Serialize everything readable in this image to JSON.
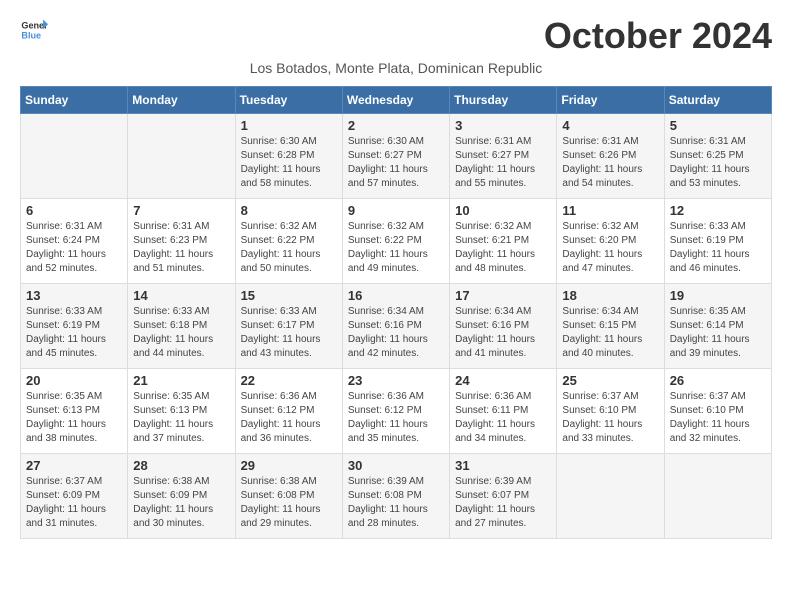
{
  "logo": {
    "line1": "General",
    "line2": "Blue"
  },
  "title": "October 2024",
  "subtitle": "Los Botados, Monte Plata, Dominican Republic",
  "days_of_week": [
    "Sunday",
    "Monday",
    "Tuesday",
    "Wednesday",
    "Thursday",
    "Friday",
    "Saturday"
  ],
  "weeks": [
    [
      {
        "day": "",
        "detail": ""
      },
      {
        "day": "",
        "detail": ""
      },
      {
        "day": "1",
        "detail": "Sunrise: 6:30 AM\nSunset: 6:28 PM\nDaylight: 11 hours and 58 minutes."
      },
      {
        "day": "2",
        "detail": "Sunrise: 6:30 AM\nSunset: 6:27 PM\nDaylight: 11 hours and 57 minutes."
      },
      {
        "day": "3",
        "detail": "Sunrise: 6:31 AM\nSunset: 6:27 PM\nDaylight: 11 hours and 55 minutes."
      },
      {
        "day": "4",
        "detail": "Sunrise: 6:31 AM\nSunset: 6:26 PM\nDaylight: 11 hours and 54 minutes."
      },
      {
        "day": "5",
        "detail": "Sunrise: 6:31 AM\nSunset: 6:25 PM\nDaylight: 11 hours and 53 minutes."
      }
    ],
    [
      {
        "day": "6",
        "detail": "Sunrise: 6:31 AM\nSunset: 6:24 PM\nDaylight: 11 hours and 52 minutes."
      },
      {
        "day": "7",
        "detail": "Sunrise: 6:31 AM\nSunset: 6:23 PM\nDaylight: 11 hours and 51 minutes."
      },
      {
        "day": "8",
        "detail": "Sunrise: 6:32 AM\nSunset: 6:22 PM\nDaylight: 11 hours and 50 minutes."
      },
      {
        "day": "9",
        "detail": "Sunrise: 6:32 AM\nSunset: 6:22 PM\nDaylight: 11 hours and 49 minutes."
      },
      {
        "day": "10",
        "detail": "Sunrise: 6:32 AM\nSunset: 6:21 PM\nDaylight: 11 hours and 48 minutes."
      },
      {
        "day": "11",
        "detail": "Sunrise: 6:32 AM\nSunset: 6:20 PM\nDaylight: 11 hours and 47 minutes."
      },
      {
        "day": "12",
        "detail": "Sunrise: 6:33 AM\nSunset: 6:19 PM\nDaylight: 11 hours and 46 minutes."
      }
    ],
    [
      {
        "day": "13",
        "detail": "Sunrise: 6:33 AM\nSunset: 6:19 PM\nDaylight: 11 hours and 45 minutes."
      },
      {
        "day": "14",
        "detail": "Sunrise: 6:33 AM\nSunset: 6:18 PM\nDaylight: 11 hours and 44 minutes."
      },
      {
        "day": "15",
        "detail": "Sunrise: 6:33 AM\nSunset: 6:17 PM\nDaylight: 11 hours and 43 minutes."
      },
      {
        "day": "16",
        "detail": "Sunrise: 6:34 AM\nSunset: 6:16 PM\nDaylight: 11 hours and 42 minutes."
      },
      {
        "day": "17",
        "detail": "Sunrise: 6:34 AM\nSunset: 6:16 PM\nDaylight: 11 hours and 41 minutes."
      },
      {
        "day": "18",
        "detail": "Sunrise: 6:34 AM\nSunset: 6:15 PM\nDaylight: 11 hours and 40 minutes."
      },
      {
        "day": "19",
        "detail": "Sunrise: 6:35 AM\nSunset: 6:14 PM\nDaylight: 11 hours and 39 minutes."
      }
    ],
    [
      {
        "day": "20",
        "detail": "Sunrise: 6:35 AM\nSunset: 6:13 PM\nDaylight: 11 hours and 38 minutes."
      },
      {
        "day": "21",
        "detail": "Sunrise: 6:35 AM\nSunset: 6:13 PM\nDaylight: 11 hours and 37 minutes."
      },
      {
        "day": "22",
        "detail": "Sunrise: 6:36 AM\nSunset: 6:12 PM\nDaylight: 11 hours and 36 minutes."
      },
      {
        "day": "23",
        "detail": "Sunrise: 6:36 AM\nSunset: 6:12 PM\nDaylight: 11 hours and 35 minutes."
      },
      {
        "day": "24",
        "detail": "Sunrise: 6:36 AM\nSunset: 6:11 PM\nDaylight: 11 hours and 34 minutes."
      },
      {
        "day": "25",
        "detail": "Sunrise: 6:37 AM\nSunset: 6:10 PM\nDaylight: 11 hours and 33 minutes."
      },
      {
        "day": "26",
        "detail": "Sunrise: 6:37 AM\nSunset: 6:10 PM\nDaylight: 11 hours and 32 minutes."
      }
    ],
    [
      {
        "day": "27",
        "detail": "Sunrise: 6:37 AM\nSunset: 6:09 PM\nDaylight: 11 hours and 31 minutes."
      },
      {
        "day": "28",
        "detail": "Sunrise: 6:38 AM\nSunset: 6:09 PM\nDaylight: 11 hours and 30 minutes."
      },
      {
        "day": "29",
        "detail": "Sunrise: 6:38 AM\nSunset: 6:08 PM\nDaylight: 11 hours and 29 minutes."
      },
      {
        "day": "30",
        "detail": "Sunrise: 6:39 AM\nSunset: 6:08 PM\nDaylight: 11 hours and 28 minutes."
      },
      {
        "day": "31",
        "detail": "Sunrise: 6:39 AM\nSunset: 6:07 PM\nDaylight: 11 hours and 27 minutes."
      },
      {
        "day": "",
        "detail": ""
      },
      {
        "day": "",
        "detail": ""
      }
    ]
  ]
}
